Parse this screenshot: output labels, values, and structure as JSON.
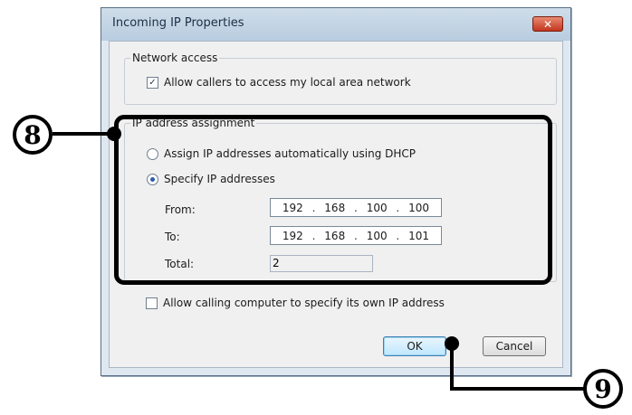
{
  "dialog": {
    "title": "Incoming IP Properties",
    "close_glyph": "✕"
  },
  "network_access": {
    "legend": "Network access",
    "allow_lan_label": "Allow callers to access my local area network",
    "allow_lan_checked": true
  },
  "ip_assignment": {
    "legend": "IP address assignment",
    "dhcp_label": "Assign IP addresses automatically using DHCP",
    "specify_label": "Specify IP addresses",
    "selected": "specify",
    "from_label": "From:",
    "from_octets": [
      "192",
      "168",
      "100",
      "100"
    ],
    "to_label": "To:",
    "to_octets": [
      "192",
      "168",
      "100",
      "101"
    ],
    "total_label": "Total:",
    "total_value": "2"
  },
  "allow_own_ip": {
    "label": "Allow calling computer to specify its own IP address",
    "checked": false
  },
  "buttons": {
    "ok": "OK",
    "cancel": "Cancel"
  },
  "callouts": {
    "step_8": "8",
    "step_9": "9"
  }
}
